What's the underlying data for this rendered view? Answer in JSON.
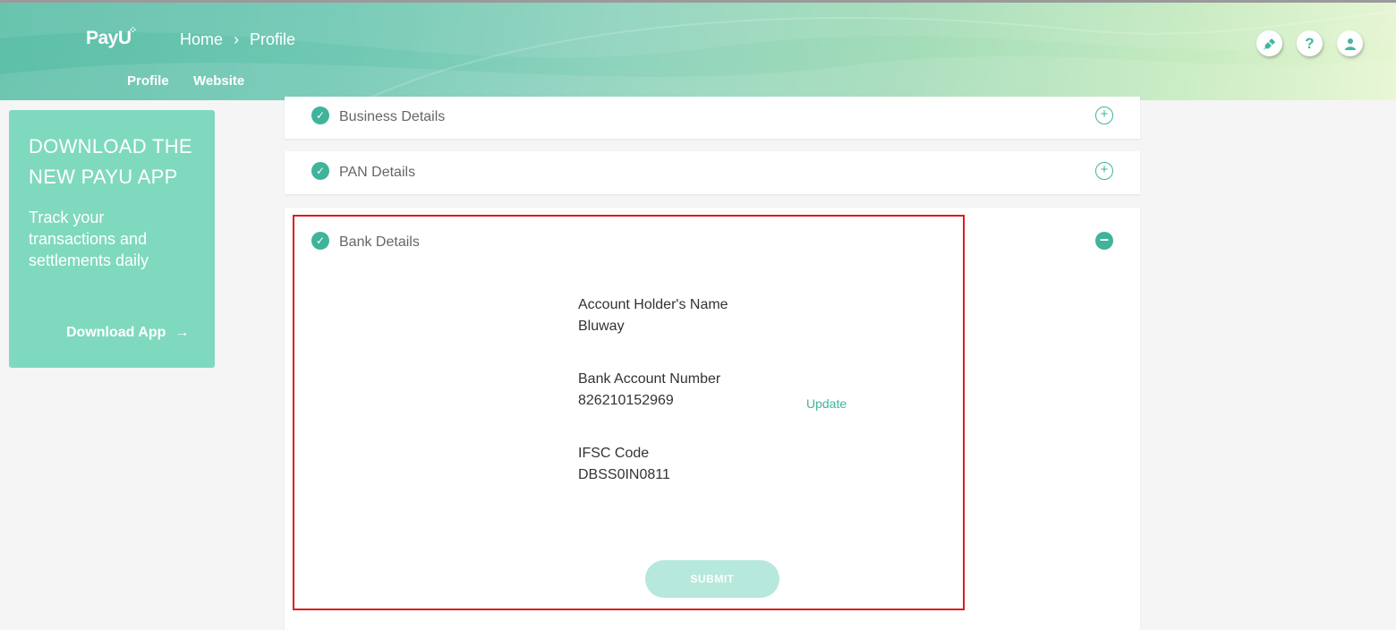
{
  "header": {
    "logo": "PayU",
    "breadcrumb": [
      "Home",
      "Profile"
    ],
    "tabs": [
      {
        "label": "Profile",
        "active": true
      },
      {
        "label": "Website",
        "active": false
      }
    ],
    "icons": [
      "plug-icon",
      "help-icon",
      "user-icon"
    ]
  },
  "promo": {
    "title": "DOWNLOAD THE NEW PAYU APP",
    "subtitle": "Track your transactions and settlements daily",
    "cta": "Download App"
  },
  "sections": [
    {
      "title": "Business Details",
      "expanded": false,
      "completed": true
    },
    {
      "title": "PAN Details",
      "expanded": false,
      "completed": true
    },
    {
      "title": "Bank Details",
      "expanded": true,
      "completed": true
    }
  ],
  "bank": {
    "holder_label": "Account Holder's Name",
    "holder_value": "Bluway",
    "account_label": "Bank Account Number",
    "account_value": "826210152969",
    "update_label": "Update",
    "ifsc_label": "IFSC Code",
    "ifsc_value": "DBSS0IN0811",
    "submit_label": "SUBMIT"
  },
  "colors": {
    "accent": "#3fb49a",
    "promo_bg": "#7fd9be",
    "highlight": "#e01a1a"
  }
}
